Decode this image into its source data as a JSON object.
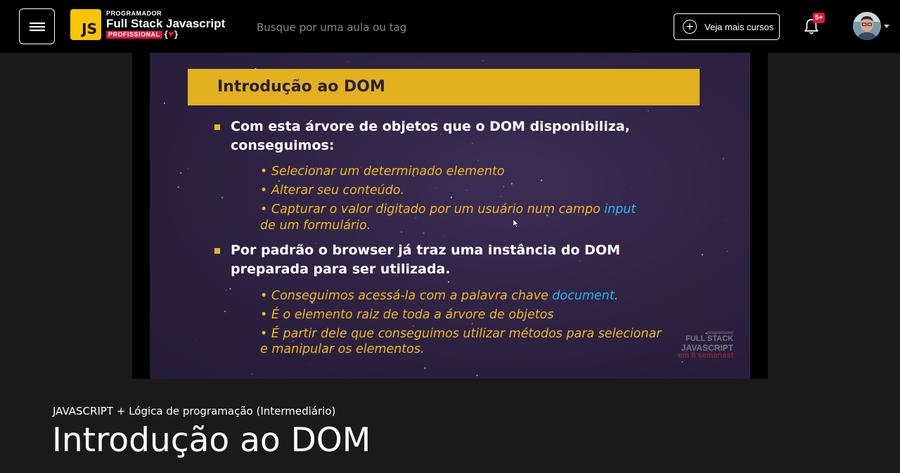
{
  "header": {
    "menu_icon": "hamburger-menu-icon",
    "logo": {
      "js": "JS",
      "line1": "PROGRAMADOR",
      "line2": "Full Stack Javascript",
      "line3": "PROFISSIONAL",
      "brace_open": "{",
      "brace_close": "}",
      "heart": "♥"
    },
    "search_placeholder": "Busque por uma aula ou tag",
    "more_courses_label": "Veja mais cursos",
    "more_courses_icon": "plus-circle-icon",
    "notification_icon": "bell-icon",
    "notification_badge": "5+",
    "avatar_icon": "user-avatar",
    "caret_icon": "caret-down-icon"
  },
  "video": {
    "slide_title": "Introdução ao DOM",
    "bullets": [
      {
        "lines": [
          "Com esta árvore de objetos que o DOM disponibiliza,",
          "conseguimos:"
        ],
        "subs": [
          {
            "text": "• Selecionar um determinado elemento"
          },
          {
            "text": "• Alterar seu conteúdo."
          },
          {
            "text": "• Capturar o valor digitado por um usuário num campo ",
            "hl": "input",
            "cont": "de um formulário."
          }
        ]
      },
      {
        "lines": [
          "Por padrão o browser já traz uma instância do DOM",
          "preparada para ser utilizada."
        ],
        "subs": [
          {
            "text": "• Conseguimos acessá-la com a palavra chave ",
            "hl": "document",
            "after": "."
          },
          {
            "text": "• É o elemento raiz de toda a árvore de objetos"
          },
          {
            "text": "• É partir dele que conseguimos utilizar métodos para selecionar",
            "cont": "e manipular os elementos."
          }
        ]
      }
    ],
    "watermark": {
      "small": "programador",
      "l1": "FULL STACK",
      "l2": "JAVASCRIPT",
      "l3": "em 8 semanas!"
    }
  },
  "lesson": {
    "category": "JAVASCRIPT + Lógica de programação (Intermediário)",
    "title": "Introdução ao DOM"
  },
  "colors": {
    "topbar": "#000000",
    "page_bg": "#1a1a1a",
    "slide_bg": "#2d2242",
    "slide_title_bar": "#e2b11f",
    "slide_sub_text": "#f0b820",
    "slide_highlight": "#1fb8e8",
    "badge": "#e0173a"
  }
}
